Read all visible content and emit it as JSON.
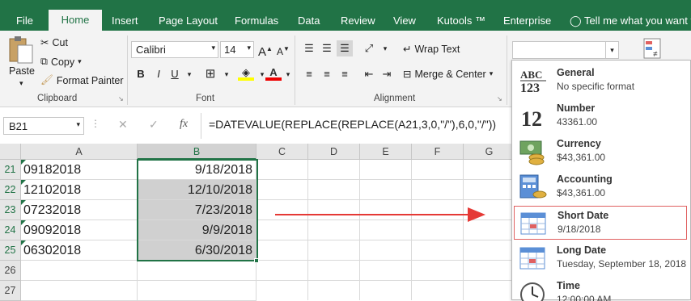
{
  "tabs": [
    "File",
    "Home",
    "Insert",
    "Page Layout",
    "Formulas",
    "Data",
    "Review",
    "View",
    "Kutools ™",
    "Enterprise"
  ],
  "tell_me": "Tell me what you want to",
  "clipboard": {
    "paste": "Paste",
    "cut": "Cut",
    "copy": "Copy",
    "format_painter": "Format Painter",
    "label": "Clipboard"
  },
  "font": {
    "name": "Calibri",
    "size": "14",
    "bold": "B",
    "italic": "I",
    "underline": "U",
    "color_a": "A",
    "label": "Font"
  },
  "alignment": {
    "wrap_text": "Wrap Text",
    "merge_center": "Merge & Center",
    "label": "Alignment"
  },
  "formula_bar": {
    "name_box": "B21",
    "formula": "=DATEVALUE(REPLACE(REPLACE(A21,3,0,\"/\"),6,0,\"/\"))",
    "cancel": "✕",
    "enter": "✓",
    "fx": "fx"
  },
  "columns": [
    "A",
    "B",
    "C",
    "D",
    "E",
    "F",
    "G"
  ],
  "rows": [
    {
      "num": "21",
      "a": "09182018",
      "b": "9/18/2018"
    },
    {
      "num": "22",
      "a": "12102018",
      "b": "12/10/2018"
    },
    {
      "num": "23",
      "a": "07232018",
      "b": "7/23/2018"
    },
    {
      "num": "24",
      "a": "09092018",
      "b": "9/9/2018"
    },
    {
      "num": "25",
      "a": "06302018",
      "b": "6/30/2018"
    },
    {
      "num": "26",
      "a": "",
      "b": ""
    },
    {
      "num": "27",
      "a": "",
      "b": ""
    }
  ],
  "number_formats": [
    {
      "name": "General",
      "value": "No specific format",
      "icon": "abc123-icon"
    },
    {
      "name": "Number",
      "value": "43361.00",
      "icon": "number-12-icon"
    },
    {
      "name": "Currency",
      "value": "$43,361.00",
      "icon": "currency-icon"
    },
    {
      "name": "Accounting",
      "value": " $43,361.00",
      "icon": "accounting-icon"
    },
    {
      "name": "Short Date",
      "value": "9/18/2018",
      "icon": "calendar-icon"
    },
    {
      "name": "Long Date",
      "value": "Tuesday, September 18, 2018",
      "icon": "calendar-icon"
    },
    {
      "name": "Time",
      "value": "12:00:00 AM",
      "icon": "clock-icon"
    }
  ],
  "colors": {
    "excel_green": "#217346",
    "arrow": "#e53935",
    "highlight": "#e06060"
  }
}
